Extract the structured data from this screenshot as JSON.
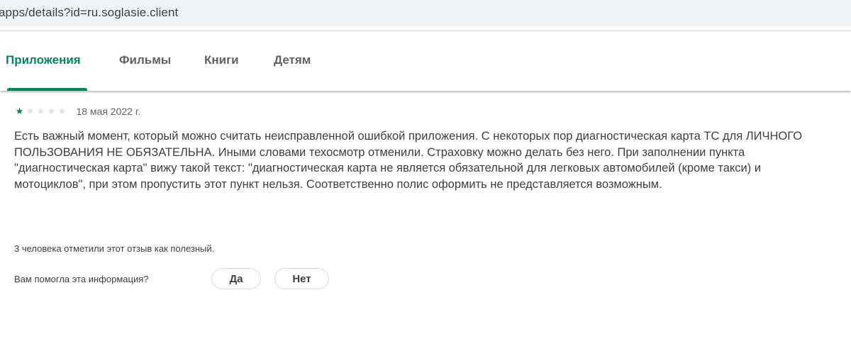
{
  "address_bar": {
    "url": "apps/details?id=ru.soglasie.client"
  },
  "tabs": [
    {
      "label": "Приложения",
      "active": true
    },
    {
      "label": "Фильмы",
      "active": false
    },
    {
      "label": "Книги",
      "active": false
    },
    {
      "label": "Детям",
      "active": false
    }
  ],
  "review": {
    "rating": 1,
    "max_rating": 5,
    "date": "18 мая 2022 г.",
    "text": "Есть важный момент, который можно считать неисправленной ошибкой приложения. С некоторых пор диагностическая карта ТС для ЛИЧНОГО ПОЛЬЗОВАНИЯ НЕ ОБЯЗАТЕЛЬНА. Иными словами техосмотр отменили. Страховку можно делать без него. При заполнении пункта \"диагностическая карта\" вижу такой текст: \"диагностическая карта не является обязательной для легковых автомобилей (кроме такси) и мотоциклов\", при этом пропустить этот пункт нельзя. Соответственно полис оформить не представляется возможным.",
    "helpful_count_text": "3 человека отметили этот отзыв как полезный.",
    "feedback_question": "Вам помогла эта информация?",
    "yes_label": "Да",
    "no_label": "Нет"
  },
  "colors": {
    "accent": "#01875f",
    "text": "#3c4043",
    "muted": "#5f6368",
    "star_empty": "#e0e0e0"
  }
}
